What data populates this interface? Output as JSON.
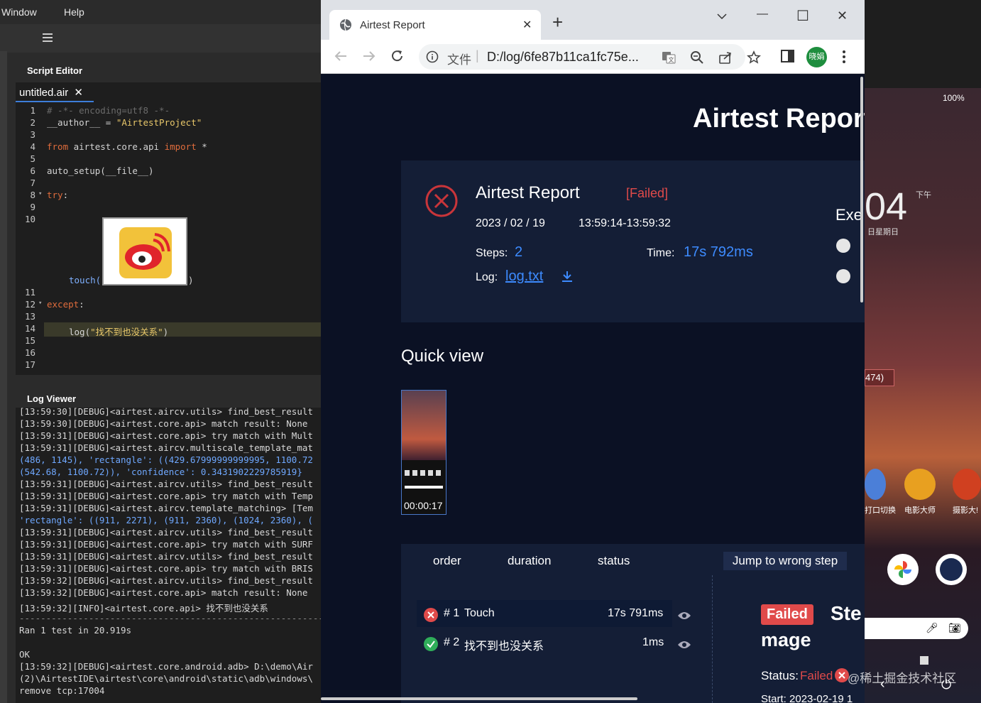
{
  "ide": {
    "menu": {
      "window": "Window",
      "help": "Help"
    },
    "script_editor_title": "Script Editor",
    "file_tab": "untitled.air",
    "file_tab_close": "✕",
    "code": {
      "l1": "# -*- encoding=utf8 -*-",
      "l2a": "__author__ = ",
      "l2b": "\"AirtestProject\"",
      "l4a": "from",
      "l4b": " airtest.core.api ",
      "l4c": "import",
      "l4d": " *",
      "l6": "auto_setup(__file__)",
      "l8": "try",
      "l8b": ":",
      "touch_a": "touch(",
      "touch_b": ")",
      "l12": "except",
      "l12b": ":",
      "l14a": "log(",
      "l14b": "\"找不到也没关系\"",
      "l14c": ")"
    },
    "line_numbers": [
      "1",
      "2",
      "3",
      "4",
      "5",
      "6",
      "7",
      "8",
      "9",
      "10",
      "11",
      "12",
      "13",
      "14",
      "15",
      "16",
      "17"
    ],
    "log_viewer_title": "Log Viewer",
    "log_lines": [
      "[13:59:30][DEBUG]<airtest.aircv.utils> find_best_result",
      "[13:59:30][DEBUG]<airtest.core.api> match result: None",
      "[13:59:31][DEBUG]<airtest.core.api> try match with Mult",
      "[13:59:31][DEBUG]<airtest.aircv.multiscale_template_mat",
      "(486, 1145), 'rectangle': ((429.67999999999995, 1100.72",
      "(542.68, 1100.72)), 'confidence': 0.3431902229785919}",
      "[13:59:31][DEBUG]<airtest.aircv.utils> find_best_result",
      "[13:59:31][DEBUG]<airtest.core.api> try match with Temp",
      "[13:59:31][DEBUG]<airtest.aircv.template_matching> [Tem",
      "'rectangle': ((911, 2271), (911, 2360), (1024, 2360), (",
      "[13:59:31][DEBUG]<airtest.aircv.utils> find_best_result",
      "[13:59:31][DEBUG]<airtest.core.api> try match with SURF",
      "[13:59:31][DEBUG]<airtest.aircv.utils> find_best_result",
      "[13:59:31][DEBUG]<airtest.core.api> try match with BRIS",
      "[13:59:32][DEBUG]<airtest.aircv.utils> find_best_result",
      "[13:59:32][DEBUG]<airtest.core.api> match result: None",
      "[13:59:32][INFO]<airtest.core.api> 找不到也没关系",
      "----------------------------------------------------------------",
      "Ran 1 test in 20.919s",
      "",
      "OK",
      "[13:59:32][DEBUG]<airtest.core.android.adb> D:\\demo\\Air",
      "(2)\\AirtestIDE\\airtest\\core\\android\\static\\adb\\windows\\",
      "remove tcp:17004"
    ]
  },
  "browser": {
    "tab_title": "Airtest Report",
    "tab_close": "✕",
    "new_tab": "+",
    "url_prefix": "文件",
    "url": "D:/log/6fe87b11ca1fc75e...",
    "profile": "晓娟",
    "window_controls": {
      "min": "—",
      "max": "☐",
      "close": "✕"
    }
  },
  "report": {
    "header": "Airtest Report",
    "summary_title": "Airtest Report",
    "status": "[Failed]",
    "date": "2023 / 02 / 19",
    "time_range": "13:59:14-13:59:32",
    "steps_label": "Steps:",
    "steps_value": "2",
    "time_label": "Time:",
    "time_value": "17s 792ms",
    "log_label": "Log:",
    "log_link": "log.txt",
    "exe_label": "Exe",
    "quick_view_title": "Quick view",
    "thumb_time": "00:00:17",
    "table_headers": {
      "order": "order",
      "duration": "duration",
      "status": "status"
    },
    "jump_button": "Jump to wrong step",
    "steps": [
      {
        "num": "# 1",
        "name": "Touch",
        "duration": "17s 791ms",
        "ok": false
      },
      {
        "num": "# 2",
        "name": "找不到也没关系",
        "duration": "1ms",
        "ok": true
      }
    ],
    "detail_badge": "Failed",
    "detail_title": "Ste",
    "detail_image": "mage",
    "detail_status_label": "Status:",
    "detail_status_value": "Failed",
    "detail_start": "Start: 2023-02-19 1"
  },
  "phone": {
    "battery": "100%",
    "clock_digits": "04",
    "clock_ampm": "下午",
    "clock_day": "日星期日",
    "coord_badge": "474)",
    "app_labels": [
      "打口切换",
      "电影大师",
      "摄影大!"
    ],
    "watermark": "@稀土掘金技术社区"
  },
  "colors": {
    "accent_blue": "#3d8bff",
    "fail_red": "#e04a4a",
    "ok_green": "#2fae5a"
  }
}
